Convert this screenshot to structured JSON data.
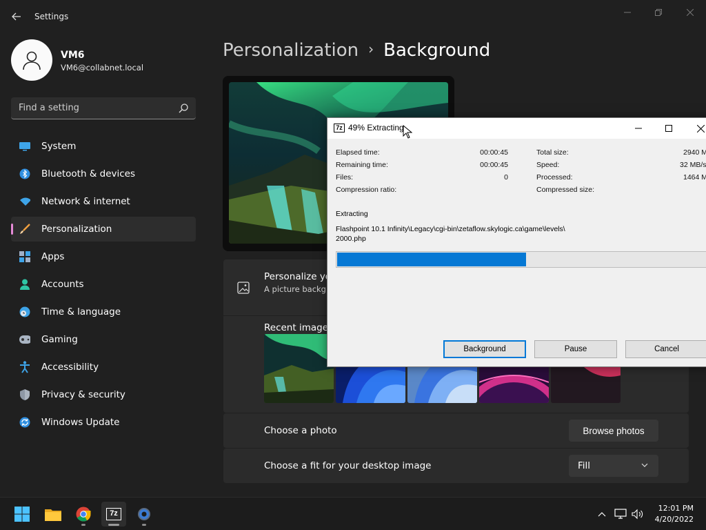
{
  "window": {
    "title": "Settings",
    "minimize_icon": "minimize-icon",
    "maximize_icon": "restore-icon",
    "close_icon": "close-icon"
  },
  "user": {
    "name": "VM6",
    "email": "VM6@collabnet.local"
  },
  "search": {
    "placeholder": "Find a setting",
    "value": ""
  },
  "nav": {
    "items": [
      {
        "label": "System",
        "icon": "monitor-icon",
        "active": false
      },
      {
        "label": "Bluetooth & devices",
        "icon": "bluetooth-icon",
        "active": false
      },
      {
        "label": "Network & internet",
        "icon": "wifi-icon",
        "active": false
      },
      {
        "label": "Personalization",
        "icon": "brush-icon",
        "active": true
      },
      {
        "label": "Apps",
        "icon": "apps-icon",
        "active": false
      },
      {
        "label": "Accounts",
        "icon": "person-icon",
        "active": false
      },
      {
        "label": "Time & language",
        "icon": "globe-clock-icon",
        "active": false
      },
      {
        "label": "Gaming",
        "icon": "gamepad-icon",
        "active": false
      },
      {
        "label": "Accessibility",
        "icon": "accessibility-icon",
        "active": false
      },
      {
        "label": "Privacy & security",
        "icon": "shield-icon",
        "active": false
      },
      {
        "label": "Windows Update",
        "icon": "update-icon",
        "active": false
      }
    ]
  },
  "breadcrumb": {
    "parent": "Personalization",
    "separator": "›",
    "current": "Background"
  },
  "personalize": {
    "title": "Personalize yo",
    "description": "A picture backgr slideshow backgr",
    "recent_title": "Recent images"
  },
  "rows": {
    "photo_label": "Choose a photo",
    "browse_label": "Browse photos",
    "fit_label": "Choose a fit for your desktop image",
    "fit_value": "Fill"
  },
  "dialog": {
    "title": "49% Extracting",
    "app_icon_text": "7z",
    "stats_left": [
      {
        "label": "Elapsed time:",
        "value": "00:00:45"
      },
      {
        "label": "Remaining time:",
        "value": "00:00:45"
      },
      {
        "label": "Files:",
        "value": "0"
      },
      {
        "label": "Compression ratio:",
        "value": ""
      }
    ],
    "stats_right": [
      {
        "label": "Total size:",
        "value": "2940 M"
      },
      {
        "label": "Speed:",
        "value": "32 MB/s"
      },
      {
        "label": "Processed:",
        "value": "1464 M"
      },
      {
        "label": "Compressed size:",
        "value": ""
      }
    ],
    "status_label": "Extracting",
    "path_line1": "Flashpoint 10.1 Infinity\\Legacy\\cgi-bin\\zetaflow.skylogic.ca\\game\\levels\\",
    "path_line2": "2000.php",
    "progress_percent": 49,
    "buttons": {
      "background": "Background",
      "pause": "Pause",
      "cancel": "Cancel"
    }
  },
  "taskbar": {
    "apps": [
      "start-icon",
      "file-explorer-icon",
      "chrome-icon",
      "7zip-icon",
      "settings-icon"
    ],
    "app_text_7z": "7z",
    "tray": [
      "chevron-up-icon",
      "network-icon",
      "volume-icon"
    ],
    "time": "12:01 PM",
    "date": "4/20/2022"
  },
  "colors": {
    "accent": "#0078d4",
    "nav_indicator": "#e58ad6",
    "progress": "#0678d4"
  }
}
